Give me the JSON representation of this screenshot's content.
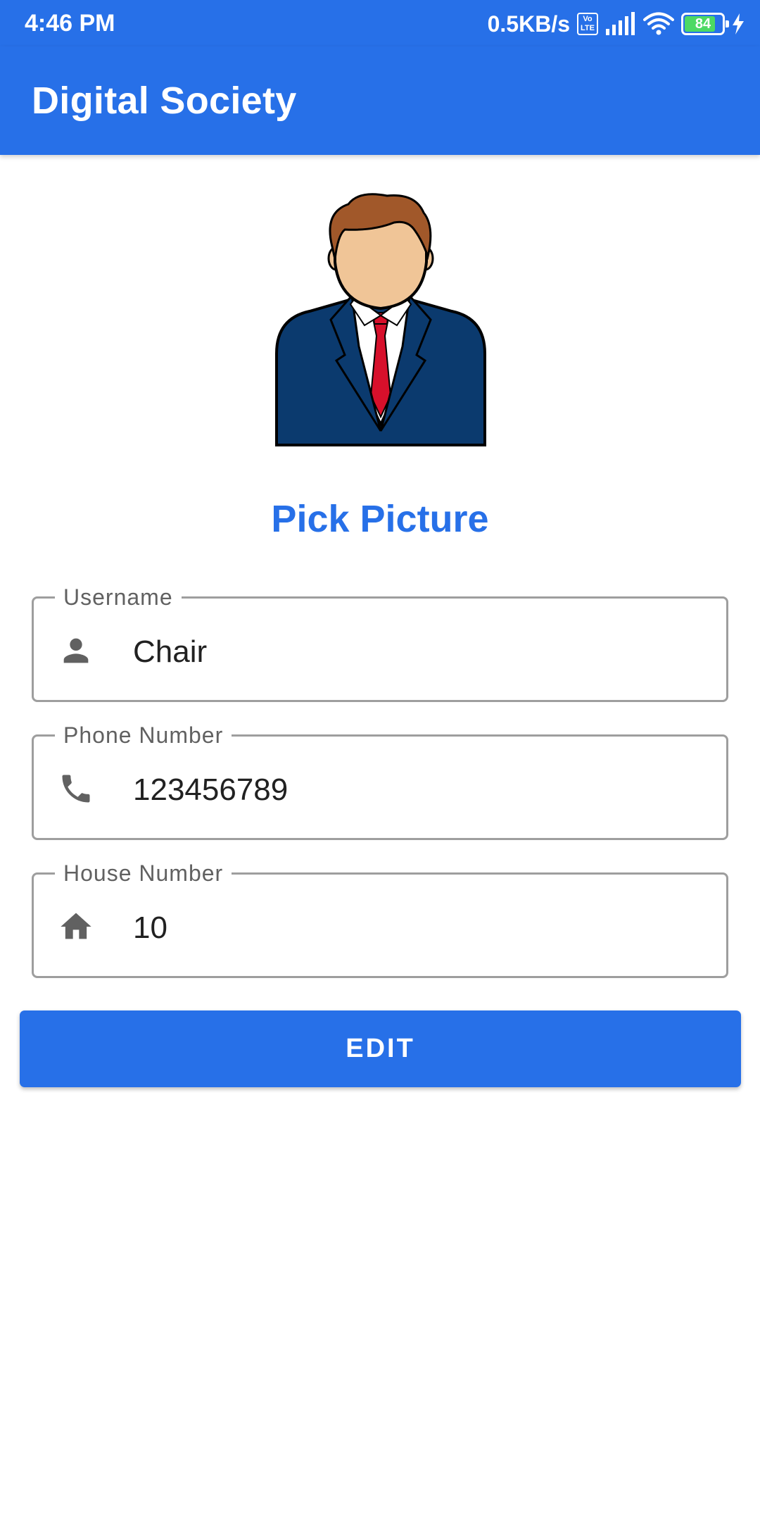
{
  "status_bar": {
    "time": "4:46 PM",
    "net_speed": "0.5KB/s",
    "volte_top": "Vo",
    "volte_bottom": "LTE",
    "battery": "84",
    "battery_level": 0.84,
    "icons": [
      "volte-icon",
      "signal-icon",
      "wifi-icon",
      "battery-icon",
      "charging-icon"
    ]
  },
  "app_bar": {
    "title": "Digital Society"
  },
  "profile": {
    "avatar_icon": "businessman-avatar",
    "pick_picture_label": "Pick Picture"
  },
  "form": {
    "fields": [
      {
        "label": "Username",
        "value": "Chair",
        "icon": "person-icon"
      },
      {
        "label": "Phone Number",
        "value": "123456789",
        "icon": "phone-icon"
      },
      {
        "label": "House Number",
        "value": "10",
        "icon": "home-icon"
      }
    ],
    "submit_label": "EDIT"
  },
  "colors": {
    "primary": "#2770E8",
    "field_border": "#9E9E9E",
    "icon_gray": "#616161"
  }
}
